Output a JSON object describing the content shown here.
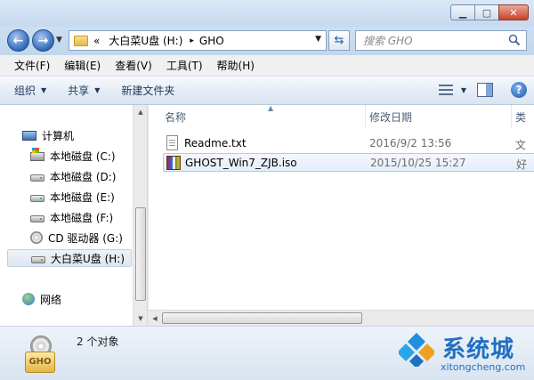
{
  "address": {
    "crumbs_prefix": "«",
    "drive": "大白菜U盘 (H:)",
    "separator": "▸",
    "folder": "GHO"
  },
  "search": {
    "placeholder": "搜索 GHO"
  },
  "menu": [
    "文件(F)",
    "编辑(E)",
    "查看(V)",
    "工具(T)",
    "帮助(H)"
  ],
  "toolbar": {
    "organize": "组织",
    "share": "共享",
    "new_folder": "新建文件夹"
  },
  "nav": {
    "computer": "计算机",
    "drives": [
      {
        "label": "本地磁盘 (C:)",
        "icon": "system-drive-icon"
      },
      {
        "label": "本地磁盘 (D:)",
        "icon": "hard-drive-icon"
      },
      {
        "label": "本地磁盘 (E:)",
        "icon": "hard-drive-icon"
      },
      {
        "label": "本地磁盘 (F:)",
        "icon": "hard-drive-icon"
      },
      {
        "label": "CD 驱动器 (G:)",
        "icon": "cd-drive-icon"
      },
      {
        "label": "大白菜U盘 (H:)",
        "icon": "usb-drive-icon"
      }
    ],
    "network": "网络"
  },
  "columns": {
    "name": "名称",
    "date": "修改日期",
    "type": "类"
  },
  "files": [
    {
      "name": "Readme.txt",
      "date": "2016/9/2 13:56",
      "type": "文"
    },
    {
      "name": "GHOST_Win7_ZJB.iso",
      "date": "2015/10/25 15:27",
      "type": "好"
    }
  ],
  "status": {
    "count": "2 个对象",
    "folder_icon_label": "GHO"
  },
  "watermark": {
    "brand": "系统城",
    "url": "xitongcheng.com"
  },
  "colors": {
    "accent": "#1f6fc2",
    "chrome": "#c9dbee"
  }
}
